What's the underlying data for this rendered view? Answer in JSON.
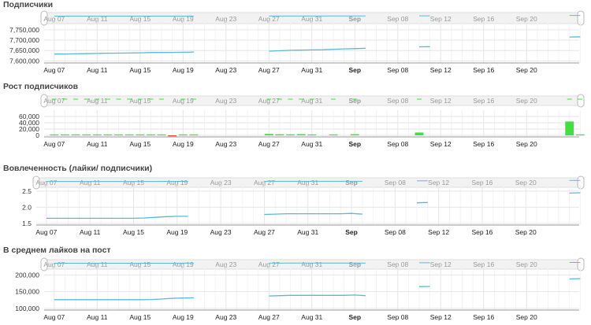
{
  "chart_data": [
    {
      "type": "line",
      "title": "Подписчики",
      "x_tick_labels": [
        "Aug 07",
        "Aug 11",
        "Aug 15",
        "Aug 19",
        "Aug 23",
        "Aug 27",
        "Aug 31",
        "Sep",
        "Sep 08",
        "Sep 12",
        "Sep 16",
        "Sep 20"
      ],
      "y_tick_labels": [
        "7,750,000",
        "7,700,000",
        "7,650,000",
        "7,600,000"
      ],
      "ylim": [
        7590000,
        7780000
      ],
      "y_ticks": [
        7600000,
        7650000,
        7700000,
        7750000
      ],
      "grid": true,
      "series": [
        {
          "segments": [
            [
              [
                0,
                7633000
              ],
              [
                1,
                7633000
              ],
              [
                2,
                7634000
              ],
              [
                3,
                7635000
              ],
              [
                4,
                7636000
              ],
              [
                5,
                7637000
              ],
              [
                6,
                7637500
              ],
              [
                7,
                7638000
              ],
              [
                8,
                7639000
              ],
              [
                9,
                7640000
              ],
              [
                10,
                7640500
              ],
              [
                11,
                7641000
              ],
              [
                12,
                7641500
              ],
              [
                13,
                7643000
              ]
            ],
            [
              [
                20,
                7647000
              ],
              [
                21,
                7649000
              ],
              [
                22,
                7651000
              ],
              [
                23,
                7652000
              ],
              [
                24,
                7653000
              ],
              [
                25,
                7654000
              ],
              [
                26,
                7656000
              ],
              [
                27,
                7658000
              ],
              [
                28,
                7659000
              ],
              [
                29,
                7661000
              ]
            ],
            [
              [
                34,
                7668000
              ],
              [
                35,
                7668500
              ]
            ],
            [
              [
                48,
                7715000
              ],
              [
                49,
                7716000
              ]
            ]
          ]
        }
      ],
      "color": "#5bb8d8"
    },
    {
      "type": "bar",
      "title": "Рост подписчиков",
      "x_tick_labels": [
        "Aug 07",
        "Aug 11",
        "Aug 15",
        "Aug 19",
        "Aug 23",
        "Aug 27",
        "Aug 31",
        "Sep",
        "Sep 08",
        "Sep 12",
        "Sep 16",
        "Sep 20"
      ],
      "y_tick_labels": [
        "60,000",
        "40,000",
        "20,000",
        "0"
      ],
      "ylim": [
        -5000,
        70000
      ],
      "y_ticks": [
        0,
        20000,
        40000,
        60000
      ],
      "grid": true,
      "bars": [
        [
          0,
          1200
        ],
        [
          1,
          1100
        ],
        [
          2,
          1000
        ],
        [
          3,
          1200
        ],
        [
          4,
          1000
        ],
        [
          5,
          1100
        ],
        [
          6,
          1000
        ],
        [
          7,
          900
        ],
        [
          8,
          1000
        ],
        [
          9,
          1100
        ],
        [
          10,
          1000
        ],
        [
          11,
          -1200
        ],
        [
          12,
          1100
        ],
        [
          13,
          1000
        ],
        [
          20,
          4500
        ],
        [
          21,
          3500
        ],
        [
          22,
          3200
        ],
        [
          23,
          3800
        ],
        [
          24,
          1500
        ],
        [
          26,
          3000
        ],
        [
          28,
          3600
        ],
        [
          34,
          9000
        ],
        [
          48,
          44000
        ],
        [
          49,
          2000
        ]
      ],
      "positive_color": "#44dd44",
      "negative_color": "#dd4444"
    },
    {
      "type": "line",
      "title": "Вовлеченность (лайки/ подписчики)",
      "x_tick_labels": [
        "Aug 07",
        "Aug 11",
        "Aug 15",
        "Aug 19",
        "Aug 23",
        "Aug 27",
        "Aug 31",
        "Sep",
        "Sep 08",
        "Sep 12",
        "Sep 16",
        "Sep 20"
      ],
      "y_tick_labels": [
        "2.5",
        "2.0",
        "1.5"
      ],
      "ylim": [
        1.45,
        2.62
      ],
      "y_ticks": [
        1.5,
        2.0,
        2.5
      ],
      "grid": true,
      "series": [
        {
          "segments": [
            [
              [
                0,
                1.66
              ],
              [
                1,
                1.66
              ],
              [
                2,
                1.66
              ],
              [
                3,
                1.66
              ],
              [
                4,
                1.66
              ],
              [
                5,
                1.66
              ],
              [
                6,
                1.66
              ],
              [
                7,
                1.66
              ],
              [
                8,
                1.66
              ],
              [
                9,
                1.67
              ],
              [
                10,
                1.69
              ],
              [
                11,
                1.71
              ],
              [
                12,
                1.72
              ],
              [
                13,
                1.72
              ]
            ],
            [
              [
                20,
                1.78
              ],
              [
                21,
                1.79
              ],
              [
                22,
                1.8
              ],
              [
                23,
                1.8
              ],
              [
                24,
                1.8
              ],
              [
                25,
                1.8
              ],
              [
                26,
                1.8
              ],
              [
                27,
                1.8
              ],
              [
                28,
                1.81
              ],
              [
                29,
                1.79
              ]
            ],
            [
              [
                34,
                2.14
              ],
              [
                35,
                2.15
              ]
            ],
            [
              [
                48,
                2.44
              ],
              [
                49,
                2.45
              ]
            ]
          ]
        }
      ],
      "color": "#5bb8d8"
    },
    {
      "type": "line",
      "title": "В среднем лайков на пост",
      "x_tick_labels": [
        "Aug 07",
        "Aug 11",
        "Aug 15",
        "Aug 19",
        "Aug 23",
        "Aug 27",
        "Aug 31",
        "Sep",
        "Sep 08",
        "Sep 12",
        "Sep 16",
        "Sep 20"
      ],
      "y_tick_labels": [
        "200,000",
        "150,000",
        "100,000"
      ],
      "ylim": [
        95000,
        222000
      ],
      "y_ticks": [
        100000,
        150000,
        200000
      ],
      "grid": true,
      "series": [
        {
          "segments": [
            [
              [
                0,
                126000
              ],
              [
                1,
                126000
              ],
              [
                2,
                126000
              ],
              [
                3,
                126000
              ],
              [
                4,
                126000
              ],
              [
                5,
                126000
              ],
              [
                6,
                126000
              ],
              [
                7,
                126000
              ],
              [
                8,
                126000
              ],
              [
                9,
                126500
              ],
              [
                10,
                128000
              ],
              [
                11,
                130000
              ],
              [
                12,
                131000
              ],
              [
                13,
                131500
              ]
            ],
            [
              [
                20,
                137000
              ],
              [
                21,
                138000
              ],
              [
                22,
                139000
              ],
              [
                23,
                139000
              ],
              [
                24,
                139000
              ],
              [
                25,
                139000
              ],
              [
                26,
                139000
              ],
              [
                27,
                139000
              ],
              [
                28,
                140000
              ],
              [
                29,
                138000
              ]
            ],
            [
              [
                34,
                165000
              ],
              [
                35,
                165500
              ]
            ],
            [
              [
                48,
                188000
              ],
              [
                49,
                189000
              ]
            ]
          ]
        }
      ],
      "color": "#5bb8d8"
    }
  ]
}
